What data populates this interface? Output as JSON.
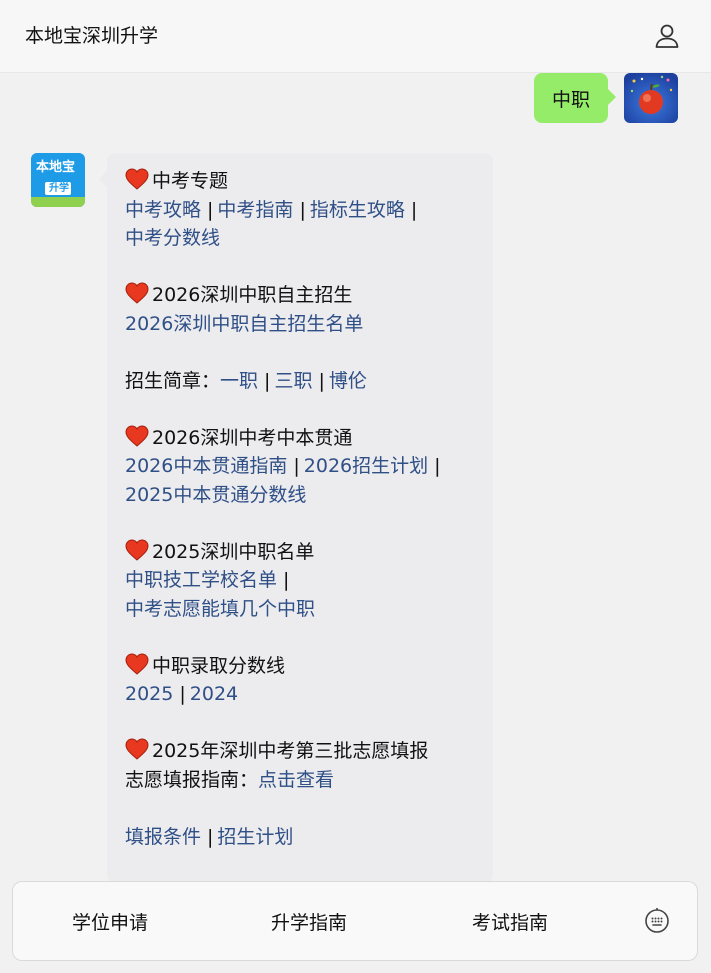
{
  "header": {
    "title": "本地宝深圳升学",
    "user_icon": "user-icon"
  },
  "messages": {
    "user_message": "中职",
    "user_avatar": "apple-avatar",
    "bot_avatar": {
      "logo_top": "本地宝",
      "logo_bottom": "升学"
    }
  },
  "bubble": {
    "s1_title": "中考专题",
    "s1_link1": "中考攻略",
    "s1_link2": "中考指南",
    "s1_link3": "指标生攻略",
    "s1_link4": "中考分数线",
    "s2_title": "2026深圳中职自主招生",
    "s2_link1": "2026深圳中职自主招生名单",
    "s3_label": "招生简章：",
    "s3_link1": "一职",
    "s3_link2": "三职",
    "s3_link3": "博伦",
    "s4_title": "2026深圳中考中本贯通",
    "s4_link1": "2026中本贯通指南",
    "s4_link2": "2026招生计划",
    "s4_link3": "2025中本贯通分数线",
    "s5_title": "2025深圳中职名单",
    "s5_link1": "中职技工学校名单",
    "s5_link2": "中考志愿能填几个中职",
    "s6_title": "中职录取分数线",
    "s6_link1": "2025",
    "s6_link2": "2024",
    "s7_title": "2025年深圳中考第三批志愿填报",
    "s7_label": "志愿填报指南：",
    "s7_link1": "点击查看",
    "s8_link1": "填报条件",
    "s8_link2": "招生计划",
    "separator": "|",
    "heart_icon": "heart-icon"
  },
  "bottom_bar": {
    "tab1": "学位申请",
    "tab2": "升学指南",
    "tab3": "考试指南",
    "keyboard_icon": "keyboard-icon"
  },
  "colors": {
    "link": "#2f4f87",
    "user_bubble": "#95ec69",
    "bot_bubble": "#ececee",
    "heart": "#e8381f"
  }
}
